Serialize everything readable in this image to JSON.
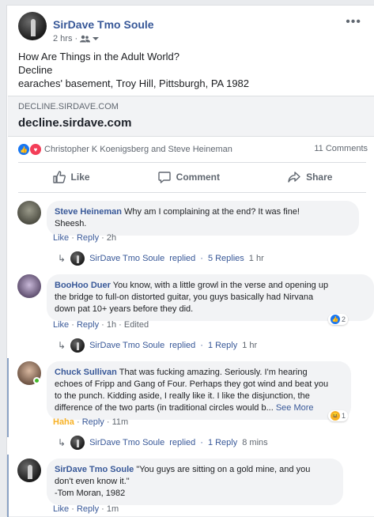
{
  "post": {
    "author": "SirDave Tmo Soule",
    "time": "2 hrs",
    "more": "•••",
    "text_lines": [
      "How Are Things in the Adult World?",
      "Decline",
      "earaches' basement, Troy Hill, Pittsburgh, PA 1982"
    ],
    "link": {
      "domain": "DECLINE.SIRDAVE.COM",
      "title": "decline.sirdave.com"
    },
    "reactions_text": "Christopher K Koenigsberg and Steve Heineman",
    "comments_count": "11 Comments",
    "actions": {
      "like": "Like",
      "comment": "Comment",
      "share": "Share"
    }
  },
  "comments": [
    {
      "name": "Steve Heineman",
      "text_lines": [
        "Why am I complaining at the end? It was fine!",
        "Sheesh."
      ],
      "like": "Like",
      "reply": "Reply",
      "time": "2h",
      "reply_summary": {
        "author": "SirDave Tmo Soule",
        "verb": "replied",
        "count": "5 Replies",
        "time": "1 hr"
      }
    },
    {
      "name": "BooHoo Duer",
      "text_lines": [
        "You know, with a little growl in the verse and opening up",
        "the bridge to full-on distorted guitar, you guys basically had Nirvana",
        "down pat 10+ years before they did."
      ],
      "like": "Like",
      "reply": "Reply",
      "time": "1h",
      "edited": "Edited",
      "reaction_count": "2",
      "reply_summary": {
        "author": "SirDave Tmo Soule",
        "verb": "replied",
        "count": "1 Reply",
        "time": "1 hr"
      }
    },
    {
      "name": "Chuck Sullivan",
      "text_lines": [
        "That was fucking amazing. Seriously. I'm hearing",
        "echoes of Fripp and Gang of Four. Perhaps they got wind and beat you",
        "to the punch. Kidding aside, I really like it. I like the disjunction, the",
        "difference of the two parts (in traditional circles would b..."
      ],
      "see_more": "See More",
      "like": "Haha",
      "reply": "Reply",
      "time": "11m",
      "reaction_count": "1",
      "reply_summary": {
        "author": "SirDave Tmo Soule",
        "verb": "replied",
        "count": "1 Reply",
        "time": "8 mins"
      }
    },
    {
      "name": "SirDave Tmo Soule",
      "text_lines": [
        "\"You guys are sitting on a gold mine, and you",
        "don't even know it.\"",
        "-Tom Moran, 1982"
      ],
      "like": "Like",
      "reply": "Reply",
      "time": "1m"
    }
  ]
}
